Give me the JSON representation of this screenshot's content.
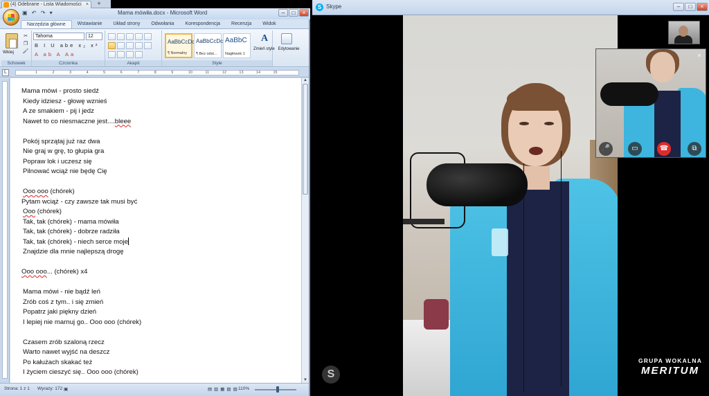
{
  "browser": {
    "tab_title": "(4) Odebrane - Lista Wiadomości",
    "close_glyph": "×",
    "new_tab_glyph": "+"
  },
  "word": {
    "title": "Mama mówiła.docx - Microsoft Word",
    "qat_glyphs": "▣ ↶ ↷ ▾",
    "window_buttons": [
      "–",
      "□",
      "×"
    ],
    "ribbon_tabs": [
      "Narzędzia główne",
      "Wstawianie",
      "Układ strony",
      "Odwołania",
      "Korespondencja",
      "Recenzja",
      "Widok"
    ],
    "active_tab_index": 0,
    "clipboard": {
      "paste_label": "Wklej",
      "group_label": "Schowek"
    },
    "font": {
      "name": "Tahoma",
      "size": "12",
      "row1": "B I U abe x₂ x²",
      "row2": "A ab A Aa",
      "group_label": "Czcionka"
    },
    "paragraph": {
      "group_label": "Akapit"
    },
    "styles": {
      "cards": [
        {
          "sample": "AaBbCcDc",
          "name": "¶ Normalny",
          "active": true
        },
        {
          "sample": "AaBbCcDc",
          "name": "¶ Bez odst...",
          "active": false
        },
        {
          "sample": "AaBbC",
          "name": "Nagłówek 1",
          "active": false
        }
      ],
      "change_label": "Zmień style",
      "group_label": "Style"
    },
    "editing": {
      "label": "Edytowanie"
    },
    "ruler": {
      "corner_glyph": "L",
      "ticks": [
        "1",
        "2",
        "3",
        "4",
        "5",
        "6",
        "7",
        "8",
        "9",
        "10",
        "11",
        "12",
        "13",
        "14",
        "15"
      ]
    },
    "document_lines": [
      {
        "text": "Mama mówi - prosto siedź",
        "indent": 0
      },
      {
        "text": "Kiedy idziesz - głowę wznieś",
        "indent": 1
      },
      {
        "text": "A ze smakiem - pij i jedz",
        "indent": 1
      },
      {
        "text": "Nawet to co niesmaczne jest....",
        "indent": 1,
        "suffix": "bleee",
        "suffix_squiggle": true
      },
      {
        "text": "",
        "indent": 0
      },
      {
        "text": "Pokój sprzątaj już raz dwa",
        "indent": 1
      },
      {
        "text": "Nie graj w grę, to głupia gra",
        "indent": 1
      },
      {
        "text": "Popraw lok i uczesz się",
        "indent": 1
      },
      {
        "text": "Pilnować wciąż nie będę Cię",
        "indent": 1
      },
      {
        "text": "",
        "indent": 0
      },
      {
        "text": "Ooo ooo (chórek)",
        "indent": 1,
        "squiggle_prefix": "Ooo ooo"
      },
      {
        "text": "Pytam wciąż - czy zawsze tak musi być",
        "indent": 0
      },
      {
        "text": "Ooo (chórek)",
        "indent": 1,
        "squiggle_prefix": "Ooo"
      },
      {
        "text": "Tak, tak (chórek) - mama mówiła",
        "indent": 1
      },
      {
        "text": "Tak, tak (chórek) - dobrze radziła",
        "indent": 1
      },
      {
        "text": "Tak, tak (chórek) - niech serce moje",
        "indent": 1,
        "caret": true
      },
      {
        "text": "Znajdzie dla mnie najlepszą drogę",
        "indent": 1
      },
      {
        "text": "",
        "indent": 0
      },
      {
        "text": "Ooo ooo... (chórek)  x4",
        "indent": 0,
        "squiggle_prefix": "Ooo ooo"
      },
      {
        "text": "",
        "indent": 0
      },
      {
        "text": "Mama mówi - nie bądź leń",
        "indent": 1
      },
      {
        "text": "Zrób coś z tym.. i się zmień",
        "indent": 1
      },
      {
        "text": "Popatrz jaki piękny dzień",
        "indent": 1
      },
      {
        "text": "I lepiej nie marnuj go.. Ooo ooo (chórek)",
        "indent": 1
      },
      {
        "text": "",
        "indent": 0
      },
      {
        "text": "Czasem zrób szaloną rzecz",
        "indent": 1
      },
      {
        "text": "Warto nawet wyjść na deszcz",
        "indent": 1
      },
      {
        "text": "Po kałużach skakać też",
        "indent": 1
      },
      {
        "text": "I życiem cieszyć się.. Ooo ooo (chórek)",
        "indent": 1
      }
    ],
    "status": {
      "page": "Strona: 1 z 1",
      "words": "Wyrazy: 172",
      "zoom": "110%",
      "zoom_fraction": 0.55
    }
  },
  "skype": {
    "title": "Skype",
    "logo_glyph": "S",
    "window_buttons": [
      "–",
      "□",
      "×"
    ],
    "pip_close": "×",
    "pip_controls": [
      "🎤",
      "▭",
      "☎",
      "⧉"
    ]
  },
  "watermark": {
    "line1": "GRUPA WOKALNA",
    "line2": "MERITUM"
  }
}
